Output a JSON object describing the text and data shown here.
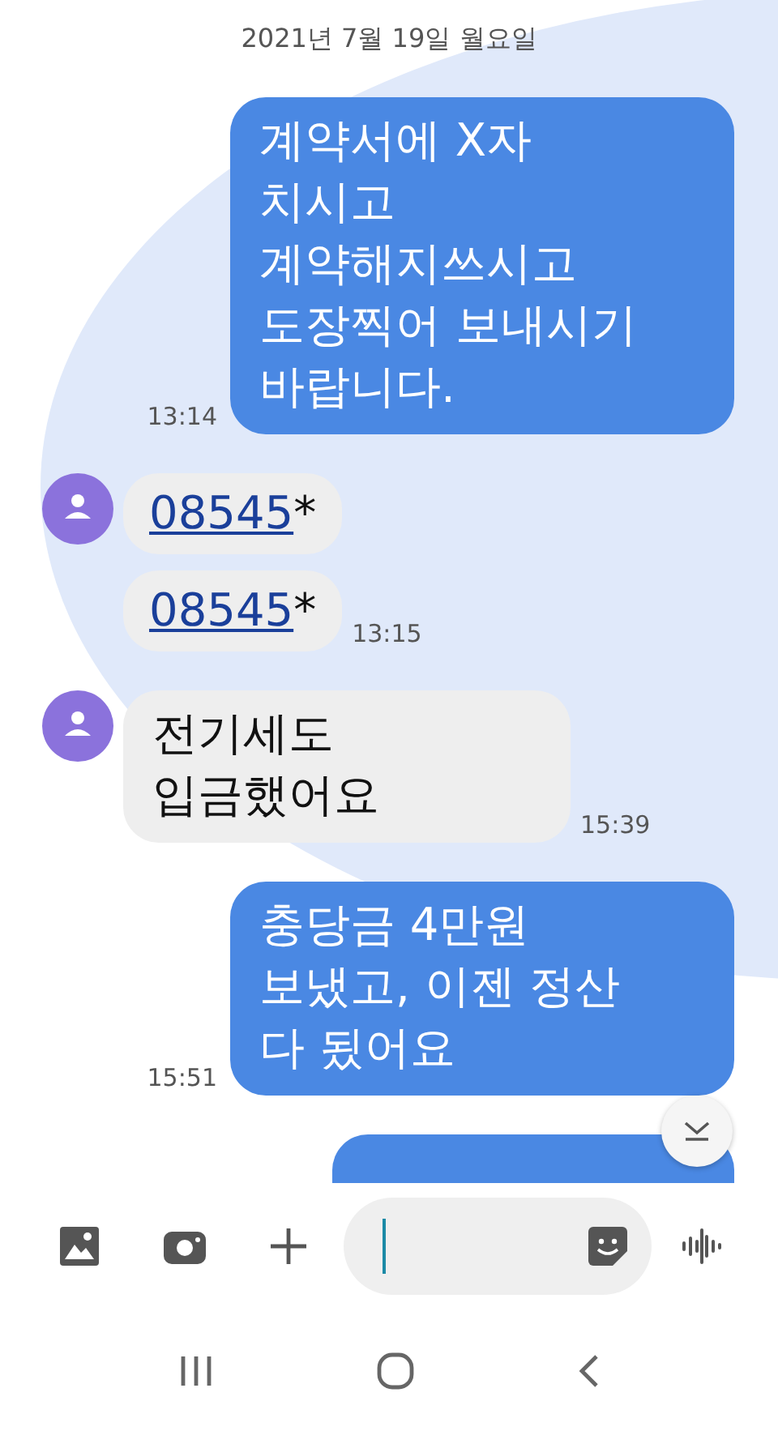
{
  "date_header": "2021년 7월 19일 월요일",
  "messages": [
    {
      "kind": "sent",
      "lines": [
        "계약서에  X자",
        "치시고",
        "계약해지쓰시고",
        "도장찍어 보내시기",
        "바랍니다."
      ],
      "time": "13:14"
    },
    {
      "kind": "received",
      "avatar": true,
      "link": "08545",
      "suffix": "*"
    },
    {
      "kind": "received",
      "avatar": false,
      "link": "08545",
      "suffix": "*",
      "time": "13:15"
    },
    {
      "kind": "received",
      "avatar": true,
      "lines": [
        "전기세도",
        "입금했어요"
      ],
      "time": "15:39"
    },
    {
      "kind": "sent",
      "lines": [
        "충당금 4만원",
        "보냈고,  이젠 정산",
        "다 됬어요"
      ],
      "time": "15:51"
    },
    {
      "kind": "cut"
    }
  ]
}
